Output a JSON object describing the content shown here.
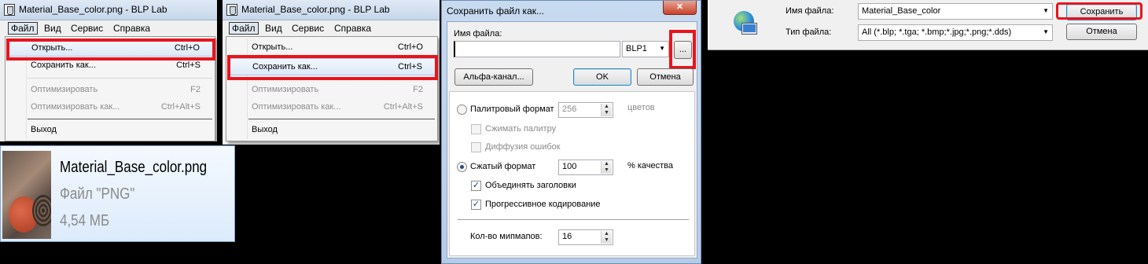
{
  "window_left": {
    "title": "Material_Base_color.png - BLP Lab",
    "menu": [
      "Файл",
      "Вид",
      "Сервис",
      "Справка"
    ],
    "items": [
      {
        "label": "Открыть...",
        "shortcut": "Ctrl+O"
      },
      {
        "label": "Сохранить как...",
        "shortcut": "Ctrl+S"
      },
      {
        "label": "Оптимизировать",
        "shortcut": "F2"
      },
      {
        "label": "Оптимизировать как...",
        "shortcut": "Ctrl+Alt+S"
      },
      {
        "label": "Выход",
        "shortcut": ""
      }
    ]
  },
  "window_mid": {
    "title": "Material_Base_color.png - BLP Lab",
    "menu": [
      "Файл",
      "Вид",
      "Сервис",
      "Справка"
    ],
    "items": [
      {
        "label": "Открыть...",
        "shortcut": "Ctrl+O"
      },
      {
        "label": "Сохранить как...",
        "shortcut": "Ctrl+S"
      },
      {
        "label": "Оптимизировать",
        "shortcut": "F2"
      },
      {
        "label": "Оптимизировать как...",
        "shortcut": "Ctrl+Alt+S"
      },
      {
        "label": "Выход",
        "shortcut": ""
      }
    ]
  },
  "file_tile": {
    "name": "Material_Base_color.png",
    "type": "Файл \"PNG\"",
    "size": "4,54 МБ"
  },
  "save_dialog": {
    "title": "Сохранить файл как...",
    "filename_label": "Имя файла:",
    "filename_value": "",
    "format_value": "BLP1",
    "browse_label": "...",
    "alpha_button": "Альфа-канал...",
    "ok_button": "OK",
    "cancel_button": "Отмена",
    "palette_label": "Палитровый формат",
    "palette_value": "256",
    "palette_unit": "цветов",
    "compress_palette": "Сжимать палитру",
    "diffusion": "Диффузия ошибок",
    "compressed_label": "Сжатый формат",
    "compressed_value": "100",
    "compressed_unit": "% качества",
    "merge_headers": "Объединять заголовки",
    "progressive": "Прогрессивное кодирование",
    "mipmaps_label": "Кол-во мипмапов:",
    "mipmaps_value": "16"
  },
  "explorer_save": {
    "filename_label": "Имя файла:",
    "filename_value": "Material_Base_color",
    "type_label": "Тип файла:",
    "type_value": "All (*.blp; *.tga; *.bmp;*.jpg;*.png;*.dds)",
    "save_button": "Сохранить",
    "cancel_button": "Отмена"
  },
  "colors": {
    "highlight": "#e8141e",
    "accent": "#3c7fb1"
  }
}
